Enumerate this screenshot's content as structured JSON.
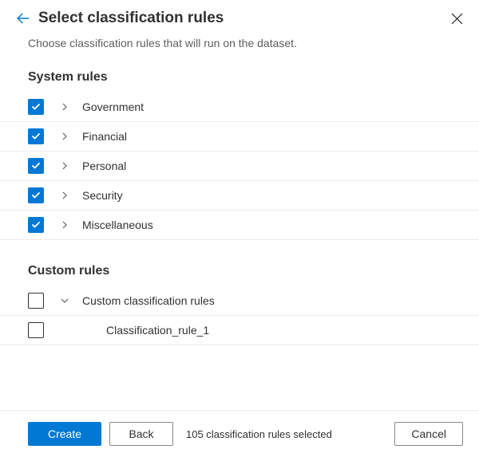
{
  "header": {
    "title": "Select classification rules"
  },
  "subtitle": "Choose classification rules that will run on the dataset.",
  "sections": {
    "system": {
      "heading": "System rules",
      "items": [
        {
          "label": "Government",
          "checked": true
        },
        {
          "label": "Financial",
          "checked": true
        },
        {
          "label": "Personal",
          "checked": true
        },
        {
          "label": "Security",
          "checked": true
        },
        {
          "label": "Miscellaneous",
          "checked": true
        }
      ]
    },
    "custom": {
      "heading": "Custom rules",
      "group": {
        "label": "Custom classification rules",
        "checked": false
      },
      "items": [
        {
          "label": "Classification_rule_1",
          "checked": false
        }
      ]
    }
  },
  "footer": {
    "create": "Create",
    "back": "Back",
    "status": "105 classification rules selected",
    "cancel": "Cancel"
  }
}
